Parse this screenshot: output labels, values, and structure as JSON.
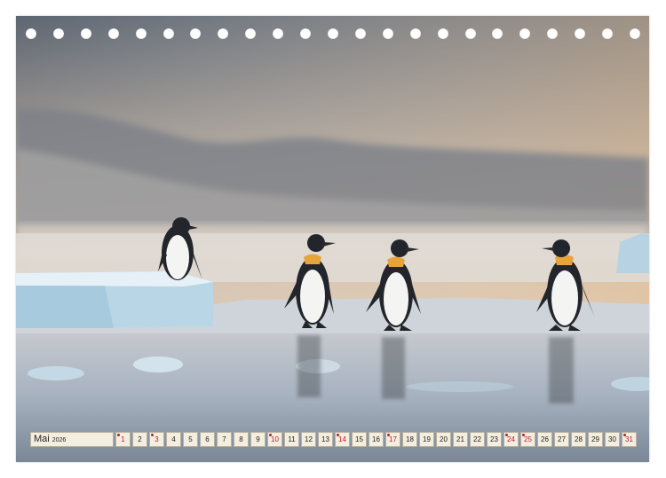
{
  "calendar": {
    "month": "Mai",
    "year": "2026",
    "days": [
      {
        "n": "1",
        "holiday": true
      },
      {
        "n": "2",
        "holiday": false
      },
      {
        "n": "3",
        "holiday": true
      },
      {
        "n": "4",
        "holiday": false
      },
      {
        "n": "5",
        "holiday": false
      },
      {
        "n": "6",
        "holiday": false
      },
      {
        "n": "7",
        "holiday": false
      },
      {
        "n": "8",
        "holiday": false
      },
      {
        "n": "9",
        "holiday": false
      },
      {
        "n": "10",
        "holiday": true
      },
      {
        "n": "11",
        "holiday": false
      },
      {
        "n": "12",
        "holiday": false
      },
      {
        "n": "13",
        "holiday": false
      },
      {
        "n": "14",
        "holiday": true
      },
      {
        "n": "15",
        "holiday": false
      },
      {
        "n": "16",
        "holiday": false
      },
      {
        "n": "17",
        "holiday": true
      },
      {
        "n": "18",
        "holiday": false
      },
      {
        "n": "19",
        "holiday": false
      },
      {
        "n": "20",
        "holiday": false
      },
      {
        "n": "21",
        "holiday": false
      },
      {
        "n": "22",
        "holiday": false
      },
      {
        "n": "23",
        "holiday": false
      },
      {
        "n": "24",
        "holiday": true
      },
      {
        "n": "25",
        "holiday": true
      },
      {
        "n": "26",
        "holiday": false
      },
      {
        "n": "27",
        "holiday": false
      },
      {
        "n": "28",
        "holiday": false
      },
      {
        "n": "29",
        "holiday": false
      },
      {
        "n": "30",
        "holiday": false
      },
      {
        "n": "31",
        "holiday": true
      }
    ]
  },
  "binding_holes": 23,
  "colors": {
    "holiday": "#c0182a",
    "cell": "#f4eedf"
  }
}
